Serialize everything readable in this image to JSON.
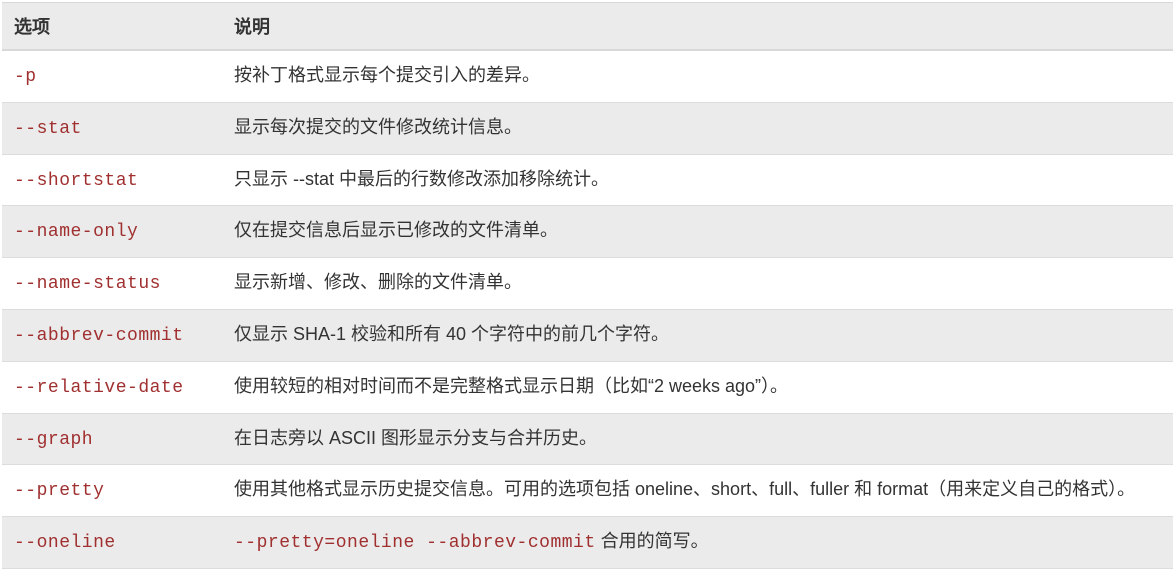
{
  "table": {
    "headers": {
      "option": "选项",
      "description": "说明"
    },
    "rows": [
      {
        "option": "-p",
        "description_parts": [
          {
            "text": "按补丁格式显示每个提交引入的差异。",
            "code": false
          }
        ]
      },
      {
        "option": "--stat",
        "description_parts": [
          {
            "text": "显示每次提交的文件修改统计信息。",
            "code": false
          }
        ]
      },
      {
        "option": "--shortstat",
        "description_parts": [
          {
            "text": "只显示 --stat 中最后的行数修改添加移除统计。",
            "code": false
          }
        ]
      },
      {
        "option": "--name-only",
        "description_parts": [
          {
            "text": "仅在提交信息后显示已修改的文件清单。",
            "code": false
          }
        ]
      },
      {
        "option": "--name-status",
        "description_parts": [
          {
            "text": "显示新增、修改、删除的文件清单。",
            "code": false
          }
        ]
      },
      {
        "option": "--abbrev-commit",
        "description_parts": [
          {
            "text": "仅显示 SHA-1 校验和所有 40 个字符中的前几个字符。",
            "code": false
          }
        ]
      },
      {
        "option": "--relative-date",
        "description_parts": [
          {
            "text": "使用较短的相对时间而不是完整格式显示日期（比如“2 weeks ago”）。",
            "code": false
          }
        ]
      },
      {
        "option": "--graph",
        "description_parts": [
          {
            "text": "在日志旁以 ASCII 图形显示分支与合并历史。",
            "code": false
          }
        ]
      },
      {
        "option": "--pretty",
        "description_parts": [
          {
            "text": "使用其他格式显示历史提交信息。可用的选项包括 oneline、short、full、fuller 和 format（用来定义自己的格式）。",
            "code": false
          }
        ]
      },
      {
        "option": "--oneline",
        "description_parts": [
          {
            "text": "--pretty=oneline --abbrev-commit",
            "code": true
          },
          {
            "text": " 合用的简写。",
            "code": false
          }
        ]
      }
    ]
  }
}
